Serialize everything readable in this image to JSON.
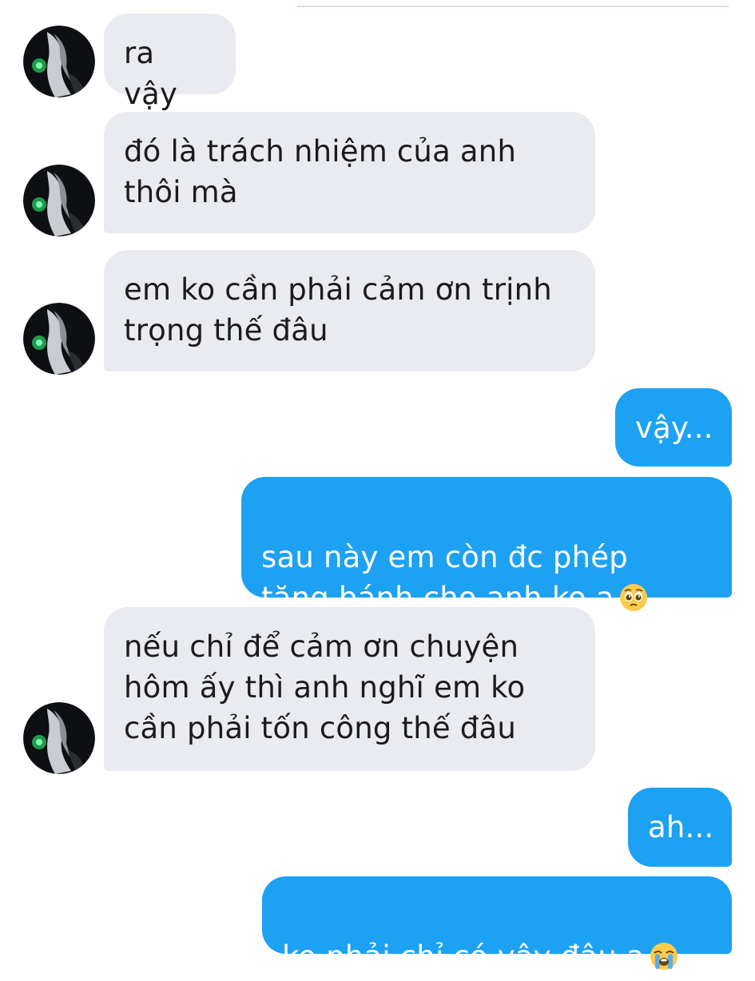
{
  "conversation": {
    "messages": [
      {
        "id": "m1",
        "side": "in",
        "text": "ra vậy",
        "avatar_icon": "contact-avatar"
      },
      {
        "id": "m2",
        "side": "in",
        "text": "đó là trách nhiệm của anh\nthôi mà",
        "avatar_icon": "contact-avatar"
      },
      {
        "id": "m3",
        "side": "in",
        "text": "em ko cần phải cảm ơn trịnh\ntrọng thế đâu",
        "avatar_icon": "contact-avatar"
      },
      {
        "id": "m4",
        "side": "out",
        "text": "vậy..."
      },
      {
        "id": "m5",
        "side": "out",
        "text": "sau này em còn đc phép\ntặng bánh cho anh ko ạ",
        "emoji_icon": "pleading-face-emoji-icon"
      },
      {
        "id": "m6",
        "side": "in",
        "text": "nếu chỉ để cảm ơn chuyện\nhôm ấy thì anh nghĩ em ko\ncần phải tốn công thế đâu",
        "avatar_icon": "contact-avatar"
      },
      {
        "id": "m7",
        "side": "out",
        "text": "ah..."
      },
      {
        "id": "m8",
        "side": "out",
        "text": "ko phải chỉ có vậy đâu ạ",
        "emoji_icon": "loudly-crying-face-emoji-icon"
      }
    ]
  },
  "colors": {
    "incoming_bubble": "#e9ebf0",
    "outgoing_bubble": "#1da1f2",
    "incoming_text": "#1b1b1b",
    "outgoing_text": "#ffffff"
  }
}
